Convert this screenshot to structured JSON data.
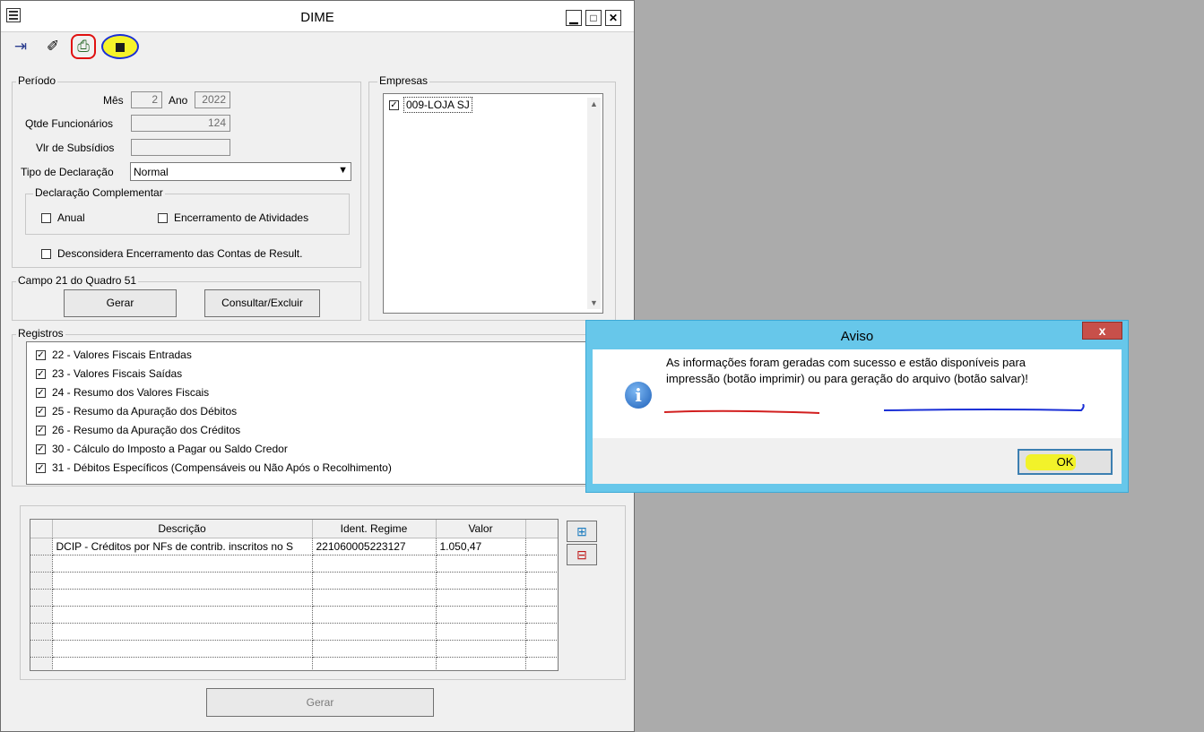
{
  "window": {
    "title": "DIME"
  },
  "toolbar": {
    "items": [
      {
        "name": "exit-icon",
        "glyph": "⇥"
      },
      {
        "name": "edit-icon",
        "glyph": "✐"
      },
      {
        "name": "print-icon",
        "glyph": "⎙"
      },
      {
        "name": "save-icon",
        "glyph": "▪"
      }
    ]
  },
  "periodo": {
    "title": "Período",
    "mes_label": "Mês",
    "mes_value": "2",
    "ano_label": "Ano",
    "ano_value": "2022",
    "qtde_label": "Qtde Funcionários",
    "qtde_value": "124",
    "vlr_label": "Vlr de Subsídios",
    "vlr_value": "",
    "tipo_label": "Tipo de Declaração",
    "tipo_value": "Normal"
  },
  "complementar": {
    "title": "Declaração Complementar",
    "anual": "Anual",
    "encerramento": "Encerramento de Atividades"
  },
  "desconsidera": "Desconsidera Encerramento das Contas de Result.",
  "campo21": {
    "title": "Campo 21 do Quadro 51",
    "gerar": "Gerar",
    "consultar": "Consultar/Excluir"
  },
  "empresas": {
    "title": "Empresas",
    "items": [
      "009-LOJA SJ"
    ]
  },
  "registros": {
    "title": "Registros",
    "items": [
      "22 - Valores Fiscais Entradas",
      "23 - Valores Fiscais Saídas",
      "24 - Resumo dos Valores Fiscais",
      "25 - Resumo da Apuração dos Débitos",
      "26 - Resumo da Apuração dos Créditos",
      "30 - Cálculo do Imposto a Pagar ou Saldo Credor",
      "31 - Débitos Específicos (Compensáveis ou Não Após o Recolhimento)"
    ]
  },
  "grid": {
    "headers": [
      "Descrição",
      "Ident. Regime",
      "Valor"
    ],
    "rows": [
      {
        "descricao": "DCIP - Créditos por NFs de contrib. inscritos no S",
        "regime": "221060005223127",
        "valor": "1.050,47"
      }
    ]
  },
  "gerar_bottom": "Gerar",
  "dialog": {
    "title": "Aviso",
    "close": "x",
    "message_line1": "As informações foram geradas com sucesso e estão disponíveis para",
    "message_line2": "impressão (botão imprimir) ou para geração do arquivo (botão salvar)!",
    "ok": "OK"
  }
}
